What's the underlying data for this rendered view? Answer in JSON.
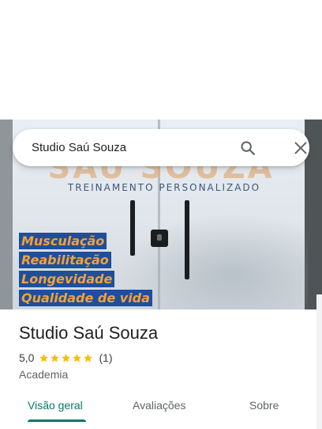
{
  "search": {
    "query": "Studio Saú Souza"
  },
  "photo": {
    "brand_text": "SAÚ SOUZA",
    "tagline": "TREINAMENTO PERSONALIZADO",
    "services": [
      "Musculação",
      "Reabilitação",
      "Longevidade",
      "Qualidade de vida"
    ]
  },
  "place": {
    "name": "Studio Saú Souza",
    "rating": "5,0",
    "stars": 5,
    "review_count": "(1)",
    "category": "Academia"
  },
  "tabs": [
    {
      "label": "Visão geral",
      "active": true
    },
    {
      "label": "Avaliações",
      "active": false
    },
    {
      "label": "Sobre",
      "active": false
    }
  ],
  "colors": {
    "accent": "#00796b",
    "star": "#fbbc04",
    "text": "#202124",
    "secondary_text": "#5f6368"
  },
  "icons": {
    "search": "search-icon",
    "close": "close-icon",
    "star": "star-icon"
  }
}
